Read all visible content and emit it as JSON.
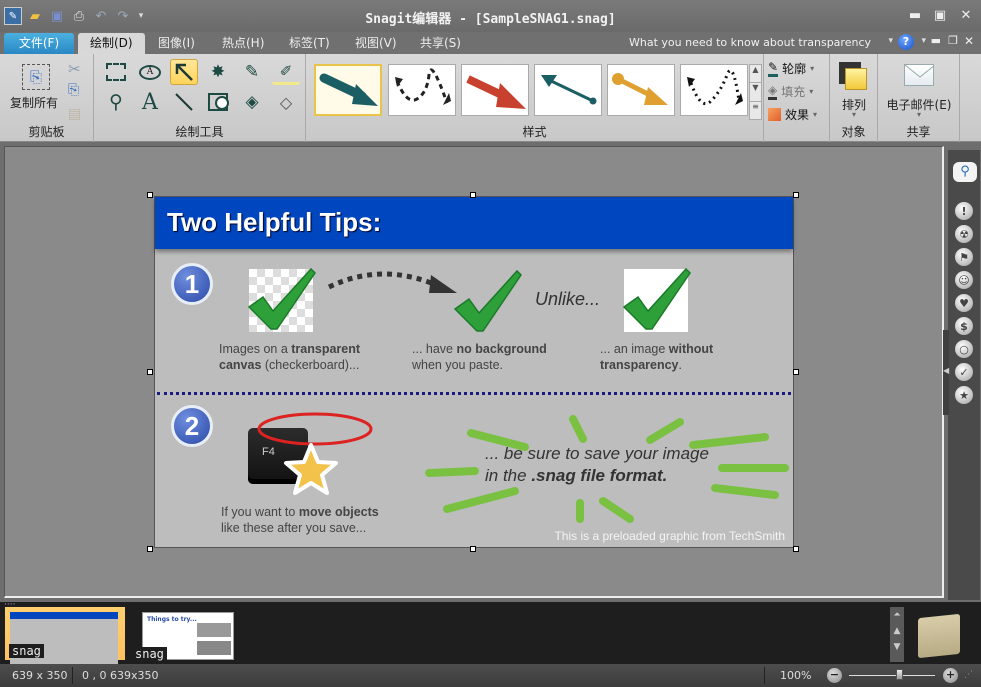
{
  "window": {
    "title": "Snagit编辑器 - [SampleSNAG1.snag]",
    "quick_access": [
      "app-icon",
      "open-icon",
      "save-icon",
      "print-icon",
      "undo-icon",
      "redo-icon",
      "customize-icon"
    ]
  },
  "tabs": {
    "file": "文件(F)",
    "items": [
      "绘制(D)",
      "图像(I)",
      "热点(H)",
      "标签(T)",
      "视图(V)",
      "共享(S)"
    ],
    "active": "绘制(D)",
    "help_text": "What you need to know about transparency"
  },
  "ribbon": {
    "clipboard": {
      "copy_all": "复制所有",
      "label": "剪贴板"
    },
    "drawing_tools": {
      "label": "绘制工具",
      "tools": [
        "selection",
        "callout",
        "arrow",
        "stamp",
        "pen",
        "highlighter",
        "zoom",
        "text",
        "line",
        "shape",
        "fill",
        "erase"
      ],
      "selected": "arrow"
    },
    "styles": {
      "label": "样式",
      "count": 6
    },
    "format": {
      "outline": "轮廓",
      "fill": "填充",
      "effects": "效果"
    },
    "object": {
      "arrange": "排列",
      "label": "对象"
    },
    "share": {
      "email": "电子邮件(E)",
      "label": "共享"
    }
  },
  "graphic": {
    "header": "Two Helpful Tips:",
    "tip1": {
      "number": "1",
      "col1_pre": "Images on a ",
      "col1_bold": "transparent",
      "col1_line2_bold": "canvas",
      "col1_line2": " (checkerboard)...",
      "col2_pre": "... have ",
      "col2_bold": "no background",
      "col2_line2": "when you paste.",
      "unlike": "Unlike...",
      "col3_pre": "... an image ",
      "col3_bold": "without",
      "col3_line2_bold": "transparency",
      "col3_line2": "."
    },
    "tip2": {
      "number": "2",
      "key": "F4",
      "text_pre": "If you want to ",
      "text_bold": "move objects",
      "text_line2": "like these after you save...",
      "save_line1": "... be sure to save your image",
      "save_line2_pre": "in the ",
      "save_line2_bold": ".snag file format.",
      "credit": "This is a preloaded graphic from TechSmith"
    }
  },
  "library_icons": [
    "search-icon",
    "exclamation-icon",
    "radiation-icon",
    "flag-icon",
    "smiley-icon",
    "heart-icon",
    "dollar-icon",
    "ring-icon",
    "check-icon",
    "star-icon"
  ],
  "tray": {
    "items": [
      {
        "label": "snag",
        "selected": true
      },
      {
        "label": "snag",
        "selected": false
      }
    ]
  },
  "status": {
    "dimensions": "639 x 350",
    "selection": "0 , 0  639x350",
    "zoom": "100%",
    "zoom_fraction": 0.6
  }
}
